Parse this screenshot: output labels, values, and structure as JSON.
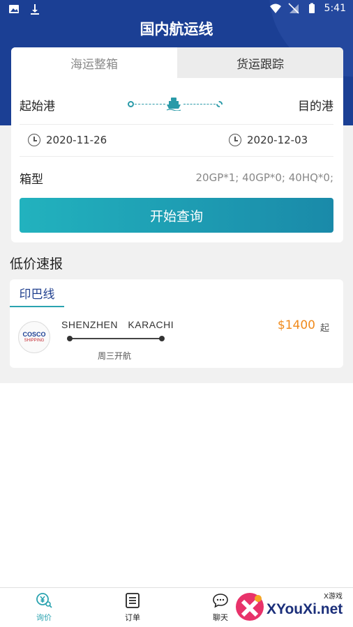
{
  "status_bar": {
    "time": "5:41"
  },
  "header": {
    "title": "国内航运线"
  },
  "search_card": {
    "tabs": [
      {
        "label": "海运整箱",
        "active": true
      },
      {
        "label": "货运跟踪",
        "active": false
      }
    ],
    "origin_label": "起始港",
    "destination_label": "目的港",
    "start_date": "2020-11-26",
    "end_date": "2020-12-03",
    "container_label": "箱型",
    "container_value": "20GP*1; 40GP*0; 40HQ*0;",
    "search_button": "开始查询"
  },
  "low_price": {
    "section_title": "低价速报",
    "route_tab": "印巴线",
    "carrier_logo": {
      "line1": "COSCO",
      "line2": "SHIPPING"
    },
    "origin": "SHENZHEN",
    "destination": "KARACHI",
    "sail_day": "周三开航",
    "price": "$1400",
    "price_suffix": "起"
  },
  "bottom_nav": [
    {
      "label": "询价",
      "icon": "yen-search-icon",
      "active": true
    },
    {
      "label": "订单",
      "icon": "order-list-icon",
      "active": false
    },
    {
      "label": "聊天",
      "icon": "chat-icon",
      "active": false
    }
  ],
  "watermark": {
    "text": "XYouXi.net",
    "small": "X游戏"
  },
  "colors": {
    "header": "#1b3f94",
    "accent": "#2aa3b0",
    "price": "#f08a1c"
  }
}
